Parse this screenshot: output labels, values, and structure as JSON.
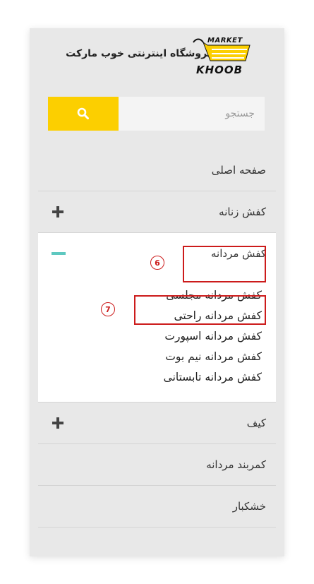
{
  "header": {
    "store_name": "فروشگاه اینترنتی خوب مارکت",
    "logo_top": "MARKET",
    "logo_bottom": "KHOOB"
  },
  "search": {
    "placeholder": "جستجو",
    "icon": "search-icon",
    "button_color": "#fccf00"
  },
  "menu": {
    "items": [
      {
        "label": "صفحه اصلی",
        "toggle": null
      },
      {
        "label": "کفش زنانه",
        "toggle": "plus"
      },
      {
        "label": "کفش مردانه",
        "toggle": "minus",
        "expanded": true
      },
      {
        "label": "کیف",
        "toggle": "plus"
      },
      {
        "label": "کمربند مردانه",
        "toggle": null
      },
      {
        "label": "خشکبار",
        "toggle": null
      }
    ],
    "submenu": [
      "کفش مردانه مجلسی",
      "کفش مردانه راحتی",
      "کفش مردانه اسپورت",
      "کفش مردانه نیم بوت",
      "کفش مردانه تابستانی"
    ]
  },
  "annotations": {
    "badge_6": "6",
    "badge_7": "7",
    "highlight_color": "#cc1b1b"
  },
  "colors": {
    "accent_minus": "#5ec8c0",
    "panel_bg": "#e8e8e8"
  }
}
